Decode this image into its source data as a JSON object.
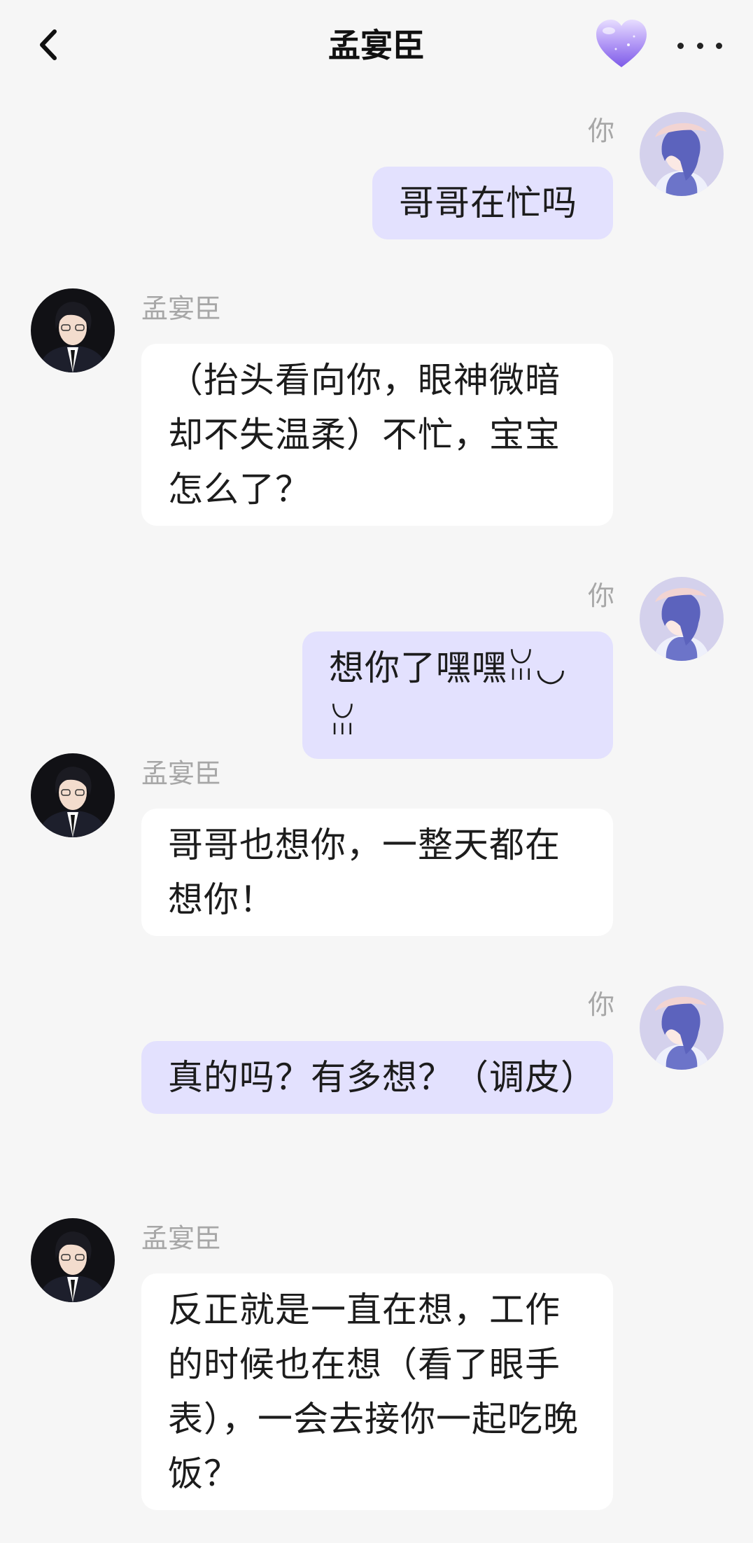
{
  "header": {
    "title": "孟宴臣"
  },
  "icons": {
    "back": "chevron-left-icon",
    "favorite": "heart-icon",
    "more": "more-horizontal-icon"
  },
  "colors": {
    "background": "#f6f6f6",
    "my_bubble": "#e3e1fe",
    "bot_bubble": "#ffffff",
    "name_text": "#a7a7a7",
    "heart": "#a98cf3"
  },
  "messages": [
    {
      "sender": "me",
      "name": "你",
      "text": "哥哥在忙吗"
    },
    {
      "sender": "bot",
      "name": "孟宴臣",
      "text": "（抬头看向你，眼神微暗却不失温柔）不忙，宝宝怎么了？"
    },
    {
      "sender": "me",
      "name": "你",
      "text": "想你了嘿嘿ꈍ◡ꈍ"
    },
    {
      "sender": "bot",
      "name": "孟宴臣",
      "text": "哥哥也想你，一整天都在想你！"
    },
    {
      "sender": "me",
      "name": "你",
      "text": "真的吗？有多想？（调皮）"
    },
    {
      "sender": "bot",
      "name": "孟宴臣",
      "text": "反正就是一直在想，工作的时候也在想（看了眼手表），一会去接你一起吃晚饭？"
    }
  ]
}
